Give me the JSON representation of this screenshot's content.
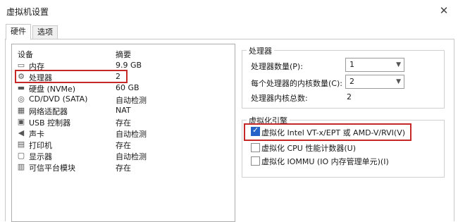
{
  "window": {
    "title": "虚拟机设置",
    "close_glyph": "✕"
  },
  "tabs": [
    {
      "label": "硬件",
      "active": true
    },
    {
      "label": "选项",
      "active": false
    }
  ],
  "device_list": {
    "headers": {
      "device": "设备",
      "summary": "摘要"
    },
    "items": [
      {
        "icon": "memory-icon",
        "glyph": "▭",
        "name": "内存",
        "summary": "9.9 GB"
      },
      {
        "icon": "processor-icon",
        "glyph": "⚙",
        "name": "处理器",
        "summary": "2",
        "selected": true
      },
      {
        "icon": "harddisk-icon",
        "glyph": "▬",
        "name": "硬盘 (NVMe)",
        "summary": "60 GB"
      },
      {
        "icon": "cd-dvd-icon",
        "glyph": "◎",
        "name": "CD/DVD (SATA)",
        "summary": "自动检测"
      },
      {
        "icon": "network-adapter-icon",
        "glyph": "▦",
        "name": "网络适配器",
        "summary": "NAT"
      },
      {
        "icon": "usb-icon",
        "glyph": "▣",
        "name": "USB 控制器",
        "summary": "存在"
      },
      {
        "icon": "sound-card-icon",
        "glyph": "◀",
        "name": "声卡",
        "summary": "自动检测"
      },
      {
        "icon": "printer-icon",
        "glyph": "▤",
        "name": "打印机",
        "summary": "存在"
      },
      {
        "icon": "display-icon",
        "glyph": "▢",
        "name": "显示器",
        "summary": "自动检测"
      },
      {
        "icon": "tpm-icon",
        "glyph": "▥",
        "name": "可信平台模块",
        "summary": "存在"
      }
    ]
  },
  "processors": {
    "group_label": "处理器",
    "count_label": "处理器数量(P):",
    "count_value": "1",
    "cores_label": "每个处理器的内核数量(C):",
    "cores_value": "2",
    "total_label": "处理器内核总数:",
    "total_value": "2"
  },
  "virtualization": {
    "group_label": "虚拟化引擎",
    "options": [
      {
        "label": "虚拟化 Intel VT-x/EPT 或 AMD-V/RVI(V)",
        "checked": true
      },
      {
        "label": "虚拟化 CPU 性能计数器(U)",
        "checked": false
      },
      {
        "label": "虚拟化 IOMMU (IO 内存管理单元)(I)",
        "checked": false
      }
    ]
  },
  "colors": {
    "highlight_border": "#c62828",
    "checkbox_checked": "#2563c9"
  }
}
